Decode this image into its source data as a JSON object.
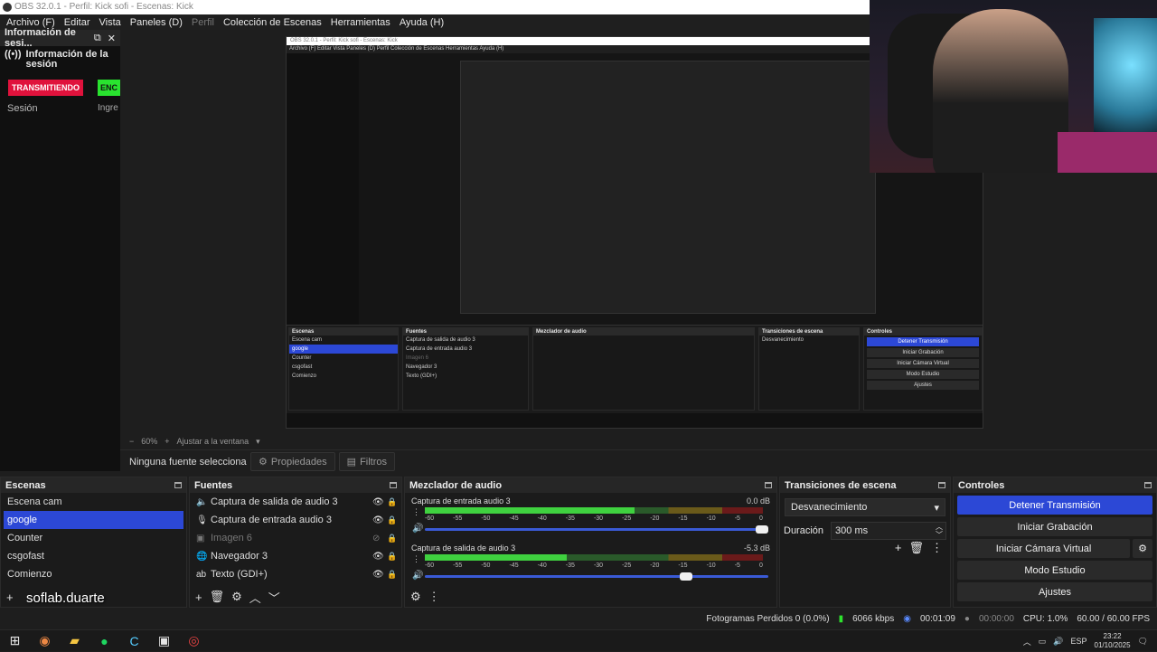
{
  "window": {
    "title": "OBS 32.0.1 - Perfil: Kick sofi - Escenas: Kick"
  },
  "menu": [
    "Archivo (F)",
    "Editar",
    "Vista",
    "Paneles (D)",
    "Perfil",
    "Colección de Escenas",
    "Herramientas",
    "Ayuda (H)"
  ],
  "info_dock": {
    "header": "Información de sesi...",
    "subtitle": "Información de la sesión",
    "live_badge": "TRANSMITIENDO",
    "green_badge": "ENC",
    "session_label": "Sesión",
    "ingr_label": "Ingre Socia"
  },
  "preview_bar": {
    "zoom": "60%",
    "fit": "Ajustar a la ventana"
  },
  "context_bar": {
    "no_selection": "Ninguna fuente seleccionad",
    "properties": "Propiedades",
    "filters": "Filtros"
  },
  "scenes": {
    "title": "Escenas",
    "items": [
      "Escena cam",
      "google",
      "Counter",
      "csgofast",
      "Comienzo"
    ],
    "selected_index": 1,
    "watermark": "soflab.duarte"
  },
  "sources": {
    "title": "Fuentes",
    "items": [
      {
        "label": "Captura de salida de audio 3",
        "icon": "speaker-icon",
        "visible": true
      },
      {
        "label": "Captura de entrada audio 3",
        "icon": "microphone-icon",
        "visible": true
      },
      {
        "label": "Imagen 6",
        "icon": "image-icon",
        "visible": false
      },
      {
        "label": "Navegador 3",
        "icon": "globe-icon",
        "visible": true
      },
      {
        "label": "Texto (GDI+)",
        "icon": "text-icon",
        "visible": true
      }
    ]
  },
  "mixer": {
    "title": "Mezclador de audio",
    "ticks": [
      "-60",
      "-55",
      "-50",
      "-45",
      "-40",
      "-35",
      "-30",
      "-25",
      "-20",
      "-15",
      "-10",
      "-5",
      "0"
    ],
    "channels": [
      {
        "name": "Captura de entrada audio 3",
        "db": "0.0 dB",
        "level": 0.62,
        "volume": 1.0
      },
      {
        "name": "Captura de salida de audio 3",
        "db": "-5.3 dB",
        "level": 0.42,
        "volume": 0.78
      }
    ]
  },
  "transitions": {
    "title": "Transiciones de escena",
    "type": "Desvanecimiento",
    "duration_label": "Duración",
    "duration": "300 ms"
  },
  "controls": {
    "title": "Controles",
    "stop_stream": "Detener Transmisión",
    "start_recording": "Iniciar Grabación",
    "start_virtualcam": "Iniciar Cámara Virtual",
    "studio_mode": "Modo Estudio",
    "settings": "Ajustes"
  },
  "status": {
    "dropped": "Fotogramas Perdidos 0 (0.0%)",
    "bitrate": "6066 kbps",
    "stream_time": "00:01:09",
    "record_time": "00:00:00",
    "cpu": "CPU: 1.0%",
    "fps": "60.00 / 60.00 FPS"
  },
  "taskbar": {
    "lang": "ESP",
    "time": "23:22",
    "date": "01/10/2025"
  },
  "colors": {
    "accent": "#2c48d6",
    "live": "#e0123c",
    "green": "#29e32f"
  }
}
